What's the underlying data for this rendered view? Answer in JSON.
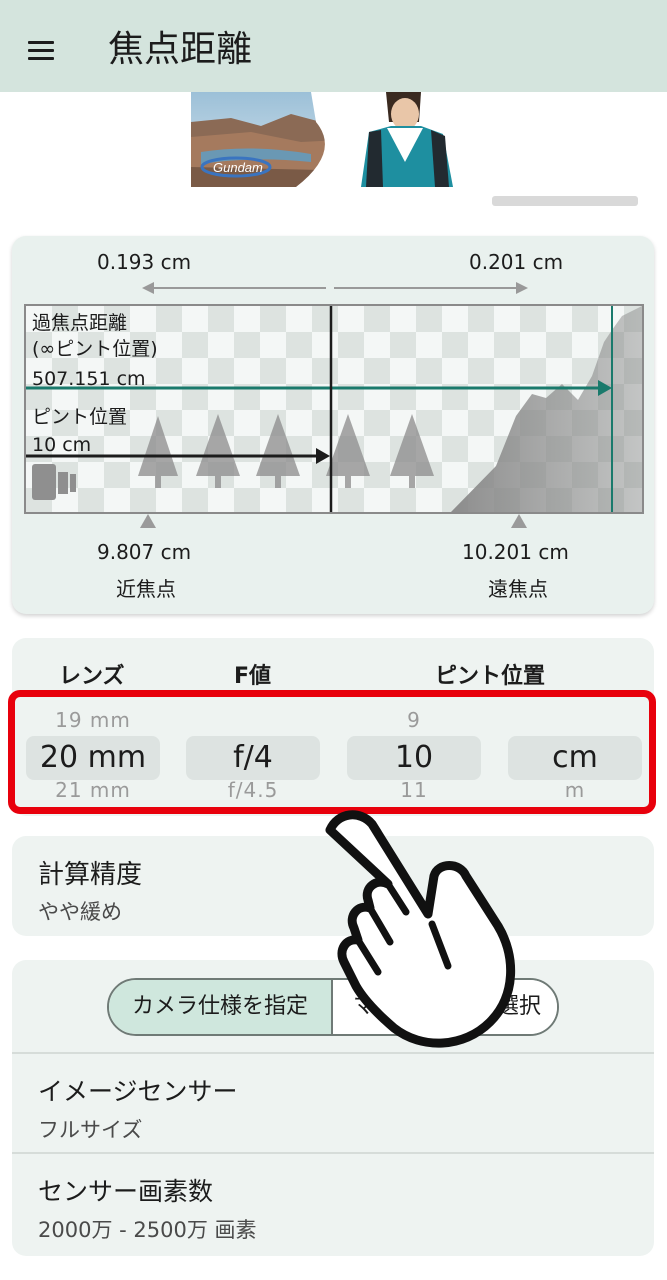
{
  "app_bar": {
    "title": "焦点距離",
    "menu_icon": "hamburger-menu-icon"
  },
  "focus_diagram": {
    "near_offset": "0.193 cm",
    "far_offset": "0.201 cm",
    "hyperfocal_label_line1": "過焦点距離",
    "hyperfocal_label_line2": "(∞ピント位置)",
    "hyperfocal_value": "507.151 cm",
    "focus_label": "ピント位置",
    "focus_value": "10 cm",
    "near_point_value": "9.807 cm",
    "near_point_label": "近焦点",
    "far_point_value": "10.201 cm",
    "far_point_label": "遠焦点",
    "accent_color": "#1a7a6c"
  },
  "picker": {
    "headers": {
      "lens": "レンズ",
      "fvalue": "F値",
      "focus": "ピント位置"
    },
    "lens": {
      "prev": "19 mm",
      "selected": "20 mm",
      "next": "21 mm"
    },
    "fvalue": {
      "prev": "",
      "selected": "f/4",
      "next": "f/4.5"
    },
    "focus": {
      "prev": "9",
      "selected": "10",
      "next": "11"
    },
    "unit": {
      "prev": "",
      "selected": "cm",
      "next": "m"
    },
    "highlight_color": "#e8000c"
  },
  "accuracy": {
    "title": "計算精度",
    "value": "やや緩め"
  },
  "camera": {
    "segment": {
      "option1": "カメラ仕様を指定",
      "option2": "マイ",
      "option2_tail": "選択",
      "selected": "カメラ仕様を指定"
    },
    "sensor": {
      "title": "イメージセンサー",
      "value": "フルサイズ"
    },
    "pixels": {
      "title": "センサー画素数",
      "value": "2000万 - 2500万 画素"
    }
  }
}
